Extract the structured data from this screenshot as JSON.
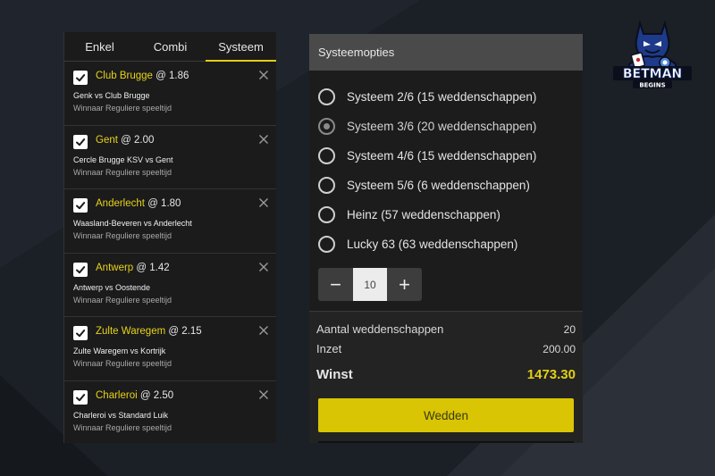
{
  "tabs": [
    {
      "label": "Enkel",
      "active": false
    },
    {
      "label": "Combi",
      "active": false
    },
    {
      "label": "Systeem",
      "active": true
    }
  ],
  "bets": [
    {
      "team": "Club Brugge",
      "odds": "@ 1.86",
      "match": "Genk  vs  Club Brugge",
      "market": "Winnaar Reguliere speeltijd"
    },
    {
      "team": "Gent",
      "odds": "@ 2.00",
      "match": "Cercle Brugge KSV  vs  Gent",
      "market": "Winnaar Reguliere speeltijd"
    },
    {
      "team": "Anderlecht",
      "odds": "@ 1.80",
      "match": "Waasland-Beveren  vs  Anderlecht",
      "market": "Winnaar Reguliere speeltijd"
    },
    {
      "team": "Antwerp",
      "odds": "@ 1.42",
      "match": "Antwerp  vs  Oostende",
      "market": "Winnaar Reguliere speeltijd"
    },
    {
      "team": "Zulte Waregem",
      "odds": "@ 2.15",
      "match": "Zulte Waregem  vs  Kortrijk",
      "market": "Winnaar Reguliere speeltijd"
    },
    {
      "team": "Charleroi",
      "odds": "@ 2.50",
      "match": "Charleroi  vs  Standard Luik",
      "market": "Winnaar Reguliere speeltijd"
    }
  ],
  "system": {
    "title": "Systeemopties",
    "options": [
      {
        "label": "Systeem 2/6 (15 weddenschappen)",
        "selected": false
      },
      {
        "label": "Systeem 3/6 (20 weddenschappen)",
        "selected": true
      },
      {
        "label": "Systeem 4/6 (15 weddenschappen)",
        "selected": false
      },
      {
        "label": "Systeem 5/6 (6 weddenschappen)",
        "selected": false
      },
      {
        "label": "Heinz (57 weddenschappen)",
        "selected": false
      },
      {
        "label": "Lucky 63 (63 weddenschappen)",
        "selected": false
      }
    ],
    "stepper": {
      "minus": "−",
      "value": "10",
      "plus": "+"
    }
  },
  "summary": {
    "count_label": "Aantal weddenschappen",
    "count_value": "20",
    "stake_label": "Inzet",
    "stake_value": "200.00",
    "win_label": "Winst",
    "win_value": "1473.30",
    "button_label": "Wedden"
  },
  "logo": {
    "line1": "BETMAN",
    "line2": "BEGINS"
  },
  "colors": {
    "accent": "#e3cf14",
    "button": "#d9c504",
    "panel": "#1b1b1b",
    "header": "#4a4a4a"
  },
  "icons": {
    "check": "checkmark-icon",
    "close": "close-icon",
    "radio": "radio-icon"
  }
}
